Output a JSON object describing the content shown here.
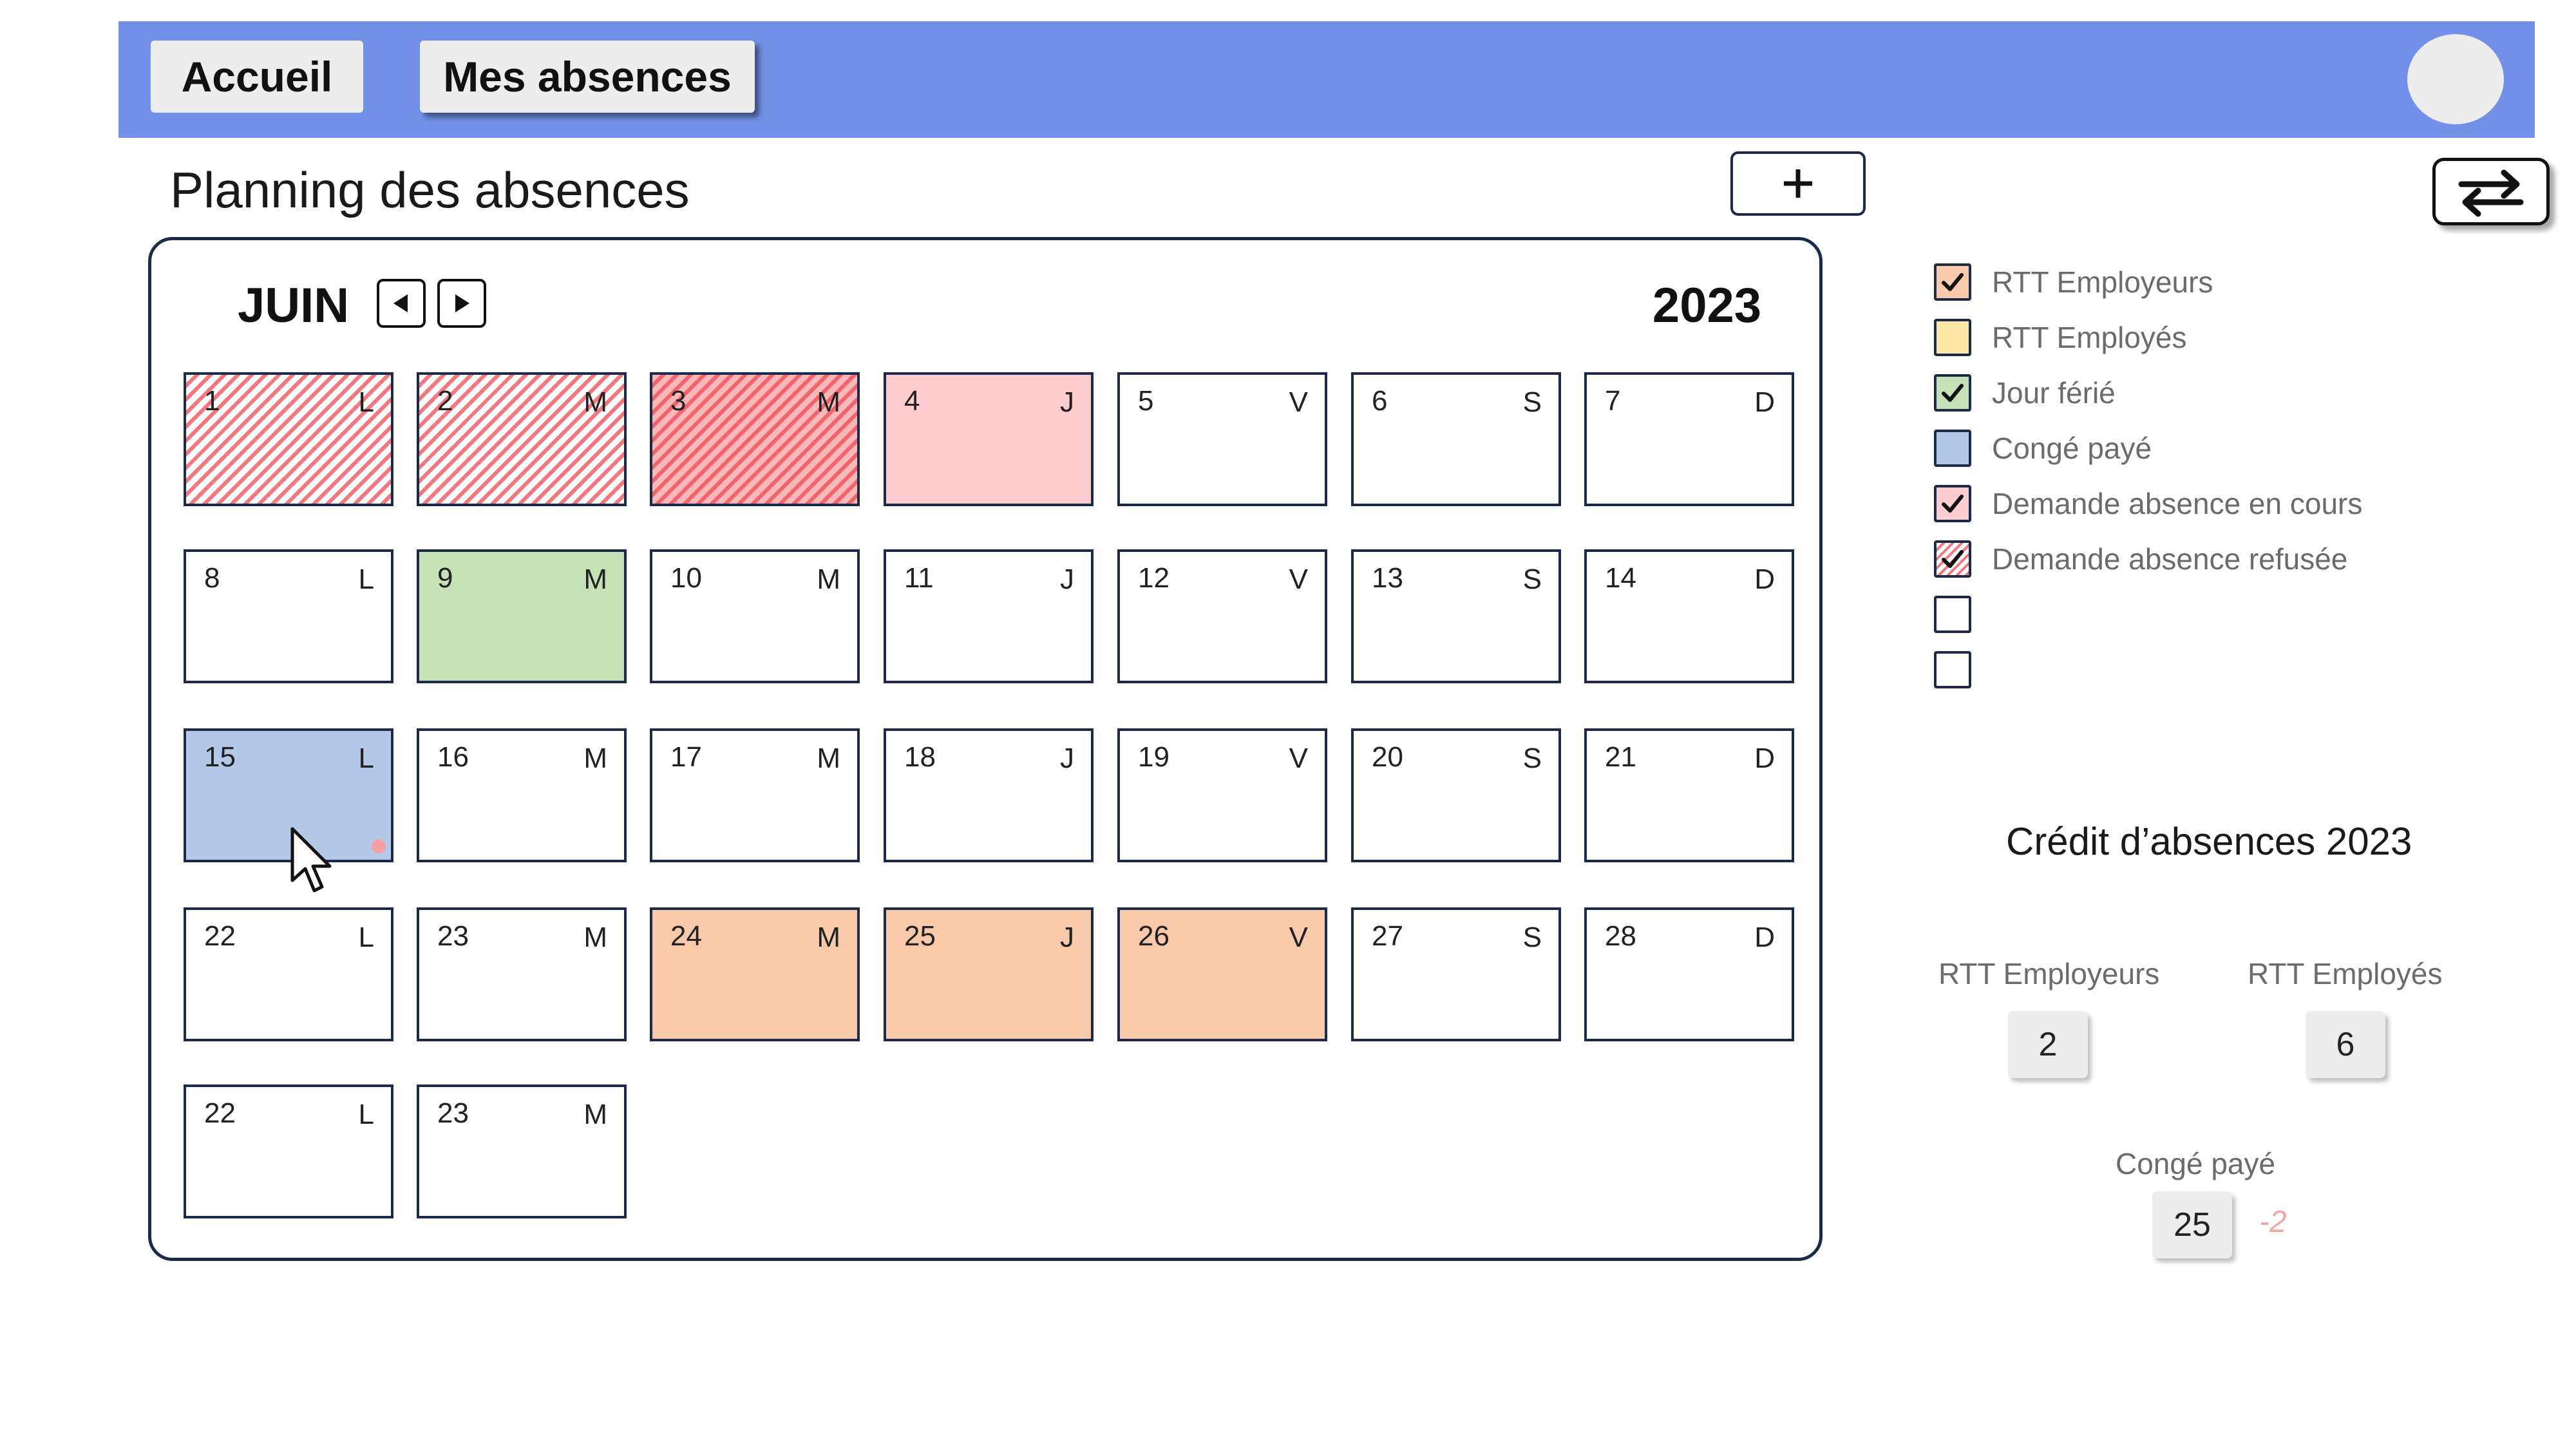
{
  "nav": {
    "home_label": "Accueil",
    "absences_label": "Mes absences"
  },
  "page": {
    "title": "Planning des absences"
  },
  "calendar": {
    "month": "JUIN",
    "year": "2023",
    "days": [
      {
        "num": "1",
        "wd": "L",
        "status": "refused"
      },
      {
        "num": "2",
        "wd": "M",
        "status": "refused"
      },
      {
        "num": "3",
        "wd": "M",
        "status": "refused-dark"
      },
      {
        "num": "4",
        "wd": "J",
        "status": "pending"
      },
      {
        "num": "5",
        "wd": "V",
        "status": ""
      },
      {
        "num": "6",
        "wd": "S",
        "status": ""
      },
      {
        "num": "7",
        "wd": "D",
        "status": ""
      },
      {
        "num": "8",
        "wd": "L",
        "status": ""
      },
      {
        "num": "9",
        "wd": "M",
        "status": "holiday"
      },
      {
        "num": "10",
        "wd": "M",
        "status": ""
      },
      {
        "num": "11",
        "wd": "J",
        "status": ""
      },
      {
        "num": "12",
        "wd": "V",
        "status": ""
      },
      {
        "num": "13",
        "wd": "S",
        "status": ""
      },
      {
        "num": "14",
        "wd": "D",
        "status": ""
      },
      {
        "num": "15",
        "wd": "L",
        "status": "paid"
      },
      {
        "num": "16",
        "wd": "M",
        "status": ""
      },
      {
        "num": "17",
        "wd": "M",
        "status": ""
      },
      {
        "num": "18",
        "wd": "J",
        "status": ""
      },
      {
        "num": "19",
        "wd": "V",
        "status": ""
      },
      {
        "num": "20",
        "wd": "S",
        "status": ""
      },
      {
        "num": "21",
        "wd": "D",
        "status": ""
      },
      {
        "num": "22",
        "wd": "L",
        "status": ""
      },
      {
        "num": "23",
        "wd": "M",
        "status": ""
      },
      {
        "num": "24",
        "wd": "M",
        "status": "rtt-emp"
      },
      {
        "num": "25",
        "wd": "J",
        "status": "rtt-emp"
      },
      {
        "num": "26",
        "wd": "V",
        "status": "rtt-emp"
      },
      {
        "num": "27",
        "wd": "S",
        "status": ""
      },
      {
        "num": "28",
        "wd": "D",
        "status": ""
      },
      {
        "num": "22",
        "wd": "L",
        "status": ""
      },
      {
        "num": "23",
        "wd": "M",
        "status": ""
      }
    ]
  },
  "legend": [
    {
      "label": "RTT Employeurs",
      "color": "#F8C9AB",
      "checked": true,
      "pattern": false
    },
    {
      "label": "RTT Employés",
      "color": "#FFE7A8",
      "checked": false,
      "pattern": false
    },
    {
      "label": "Jour férié",
      "color": "#C5E1B6",
      "checked": true,
      "pattern": false
    },
    {
      "label": "Congé payé",
      "color": "#B4C8E8",
      "checked": false,
      "pattern": false
    },
    {
      "label": "Demande absence en cours",
      "color": "#FFCCCF",
      "checked": true,
      "pattern": false
    },
    {
      "label": "Demande absence refusée",
      "color": "#FFFFFF",
      "checked": true,
      "pattern": true
    },
    {
      "label": "",
      "color": "#FFFFFF",
      "checked": false,
      "pattern": false
    },
    {
      "label": "",
      "color": "#FFFFFF",
      "checked": false,
      "pattern": false
    }
  ],
  "credits": {
    "title": "Crédit d’absences 2023",
    "rtt_employeurs_label": "RTT Employeurs",
    "rtt_employeurs_value": "2",
    "rtt_employes_label": "RTT Employés",
    "rtt_employes_value": "6",
    "conge_paye_label": "Congé payé",
    "conge_paye_value": "25",
    "conge_paye_delta": "-2"
  },
  "colors": {
    "header": "#7290E8",
    "border": "#1b2a4a",
    "refused_stripe": "#F3777D"
  },
  "icons": {
    "add": "plus-icon",
    "swap": "swap-arrows-icon",
    "prev": "triangle-left-icon",
    "next": "triangle-right-icon",
    "check": "checkmark-icon",
    "cursor": "mouse-pointer-icon"
  }
}
